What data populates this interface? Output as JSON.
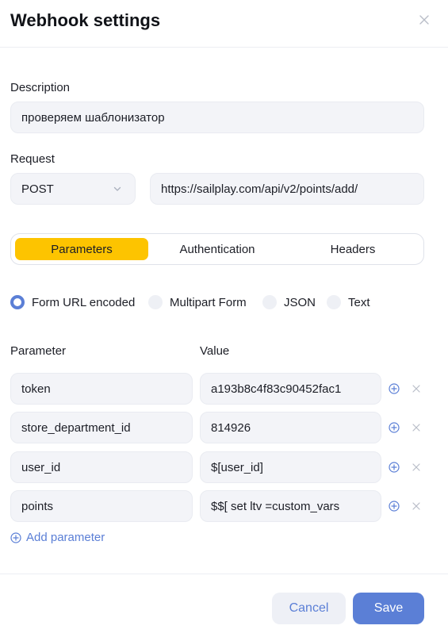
{
  "dialog": {
    "title": "Webhook settings",
    "close_icon": "close-icon"
  },
  "description": {
    "label": "Description",
    "value": "проверяем шаблонизатор"
  },
  "request": {
    "label": "Request",
    "method": "POST",
    "url": "https://sailplay.com/api/v2/points/add/"
  },
  "tabs": [
    {
      "label": "Parameters",
      "active": true
    },
    {
      "label": "Authentication",
      "active": false
    },
    {
      "label": "Headers",
      "active": false
    }
  ],
  "body_format": [
    {
      "label": "Form URL encoded",
      "checked": true
    },
    {
      "label": "Multipart Form",
      "checked": false
    },
    {
      "label": "JSON",
      "checked": false
    },
    {
      "label": "Text",
      "checked": false
    }
  ],
  "params": {
    "col_parameter": "Parameter",
    "col_value": "Value",
    "rows": [
      {
        "name": "token",
        "value": "a193b8c4f83c90452fac1"
      },
      {
        "name": "store_department_id",
        "value": "814926"
      },
      {
        "name": "user_id",
        "value": "$[user_id]"
      },
      {
        "name": "points",
        "value": "$$[ set ltv =custom_vars"
      }
    ],
    "add_label": "Add parameter"
  },
  "footer": {
    "cancel_label": "Cancel",
    "save_label": "Save"
  },
  "colors": {
    "accent_blue": "#5b7fd6",
    "tab_active": "#fdc400",
    "field_bg": "#f3f4f8"
  }
}
